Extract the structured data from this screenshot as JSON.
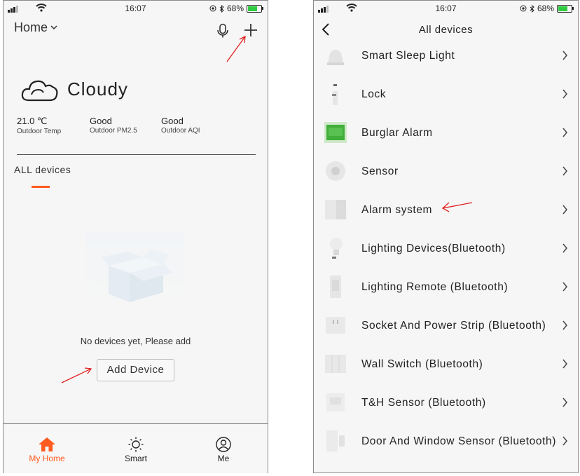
{
  "status_bar": {
    "time": "16:07",
    "battery": "68%"
  },
  "home": {
    "title": "Home",
    "weather": {
      "condition": "Cloudy"
    },
    "stats": [
      {
        "value": "21.0 ℃",
        "label": "Outdoor Temp"
      },
      {
        "value": "Good",
        "label": "Outdoor PM2.5"
      },
      {
        "value": "Good",
        "label": "Outdoor AQI"
      }
    ],
    "tab_label": "ALL devices",
    "empty_text": "No devices yet, Please add",
    "add_button": "Add Device",
    "tabbar": [
      {
        "label": "My Home",
        "icon": "home-icon",
        "active": true
      },
      {
        "label": "Smart",
        "icon": "sun-icon",
        "active": false
      },
      {
        "label": "Me",
        "icon": "person-icon",
        "active": false
      }
    ]
  },
  "all_devices": {
    "title": "All devices",
    "items": [
      {
        "label": "Smart Sleep Light",
        "icon": "sleep-light-icon"
      },
      {
        "label": "Lock",
        "icon": "lock-icon"
      },
      {
        "label": "Burglar Alarm",
        "icon": "burglar-alarm-icon"
      },
      {
        "label": "Sensor",
        "icon": "sensor-icon"
      },
      {
        "label": "Alarm system",
        "icon": "alarm-system-icon"
      },
      {
        "label": "Lighting Devices(Bluetooth)",
        "icon": "bulb-icon"
      },
      {
        "label": "Lighting Remote (Bluetooth)",
        "icon": "remote-icon"
      },
      {
        "label": "Socket And Power Strip (Bluetooth)",
        "icon": "socket-icon"
      },
      {
        "label": "Wall Switch (Bluetooth)",
        "icon": "wall-switch-icon"
      },
      {
        "label": "T&H Sensor (Bluetooth)",
        "icon": "th-sensor-icon"
      },
      {
        "label": "Door And Window Sensor (Bluetooth)",
        "icon": "door-sensor-icon"
      }
    ]
  },
  "colors": {
    "accent": "#ff5a1f",
    "annotation": "#e02020"
  }
}
